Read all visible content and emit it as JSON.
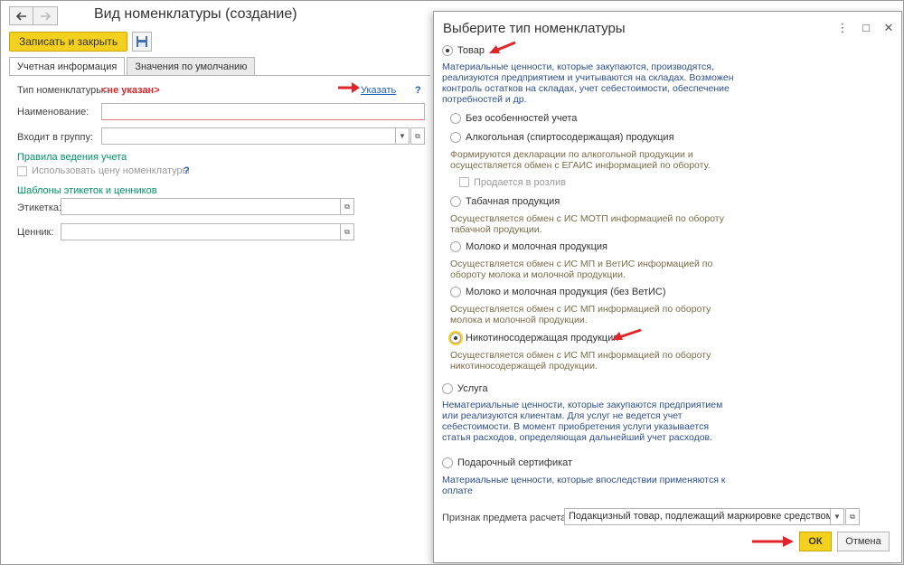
{
  "main": {
    "title": "Вид номенклатуры  (создание)",
    "save_close": "Записать и закрыть",
    "tabs": [
      "Учетная информация",
      "Значения по умолчанию"
    ],
    "type_label": "Тип номенклатуры:",
    "type_value": "<не указан>",
    "specify_link": "Указать",
    "help": "?",
    "name_label": "Наименование:",
    "group_label": "Входит в группу:",
    "rules_section": "Правила ведения учета",
    "use_price_label": "Использовать цену номенклатуры",
    "templates_section": "Шаблоны этикеток и ценников",
    "label_label": "Этикетка:",
    "price_tag_label": "Ценник:"
  },
  "dialog": {
    "title": "Выберите тип номенклатуры",
    "controls": {
      "more": "⋮",
      "maximize": "□",
      "close": "✕"
    },
    "goods": {
      "label": "Товар",
      "desc": [
        "Материальные ценности, которые закупаются, производятся,",
        "реализуются предприятием и учитываются на складах. Возможен",
        "контроль остатков на складах, учет себестоимости, обеспечение",
        "потребностей и др."
      ]
    },
    "sub_options": [
      {
        "label": "Без особенностей учета",
        "desc": []
      },
      {
        "label": "Алкогольная (спиртосодержащая) продукция",
        "desc": [
          "Формируются декларации по алкогольной продукции и",
          "осуществляется обмен с ЕГАИС информацией по обороту."
        ]
      },
      {
        "label": "Табачная продукция",
        "desc": [
          "Осуществляется обмен с ИС МОТП информацией по обороту",
          "табачной продукции."
        ]
      },
      {
        "label": "Молоко и молочная продукция",
        "desc": [
          "Осуществляется обмен с ИС МП и ВетИС информацией по",
          "обороту молока и молочной продукции."
        ]
      },
      {
        "label": "Молоко и молочная продукция (без ВетИС)",
        "desc": [
          "Осуществляется обмен с ИС МП информацией по обороту",
          "молока и молочной продукции."
        ]
      },
      {
        "label": "Никотиносодержащая продукция",
        "desc": [
          "Осуществляется обмен с ИС МП информацией по обороту",
          "никотиносодержащей продукции."
        ]
      }
    ],
    "retail_label": "Продается в розлив",
    "service": {
      "label": "Услуга",
      "desc": [
        "Нематериальные ценности, которые закупаются предприятием",
        "или реализуются клиентам. Для услуг не ведется учет",
        "себестоимости. В момент приобретения услуги указывается",
        "статья расходов, определяющая дальнейший учет расходов."
      ]
    },
    "gift": {
      "label": "Подарочный сертификат",
      "desc": [
        "Материальные ценности, которые впоследствии применяются к",
        "оплате"
      ]
    },
    "payment_label": "Признак предмета расчета:",
    "payment_value": "Подакцизный товар, подлежащий маркировке средством ид",
    "ok": "ОК",
    "cancel": "Отмена"
  }
}
